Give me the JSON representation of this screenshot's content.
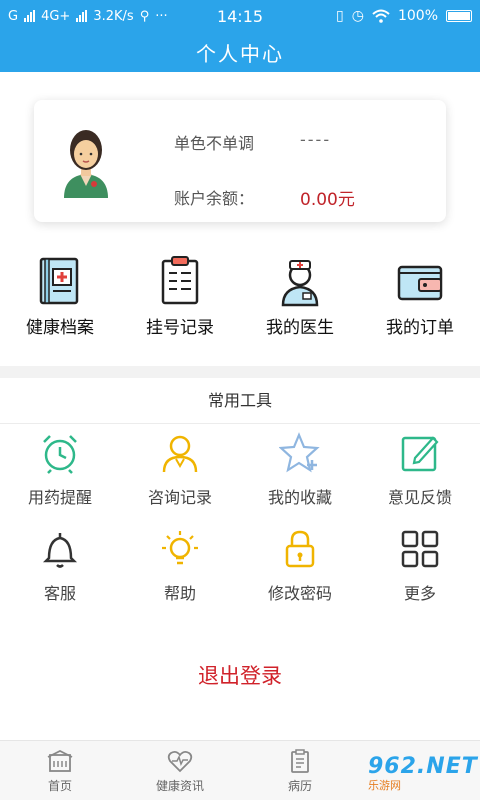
{
  "status_bar": {
    "left": "G",
    "network": "4G+",
    "speed": "3.2K/s",
    "extra": "···",
    "time": "14:15",
    "battery": "100%"
  },
  "header": {
    "title": "个人中心"
  },
  "profile": {
    "name_label": "单色不单调",
    "name_value": "----",
    "balance_label": "账户余额：",
    "balance_value": "0.00元"
  },
  "quick_actions": [
    {
      "label": "健康档案",
      "icon": "health-record-icon"
    },
    {
      "label": "挂号记录",
      "icon": "registration-record-icon"
    },
    {
      "label": "我的医生",
      "icon": "doctor-icon"
    },
    {
      "label": "我的订单",
      "icon": "order-wallet-icon"
    }
  ],
  "tools": {
    "title": "常用工具",
    "items": [
      {
        "label": "用药提醒",
        "icon": "alarm-clock-icon",
        "color": "#2eb88a"
      },
      {
        "label": "咨询记录",
        "icon": "user-consult-icon",
        "color": "#f0b400"
      },
      {
        "label": "我的收藏",
        "icon": "star-add-icon",
        "color": "#8fb6e0"
      },
      {
        "label": "意见反馈",
        "icon": "feedback-edit-icon",
        "color": "#2eb88a"
      },
      {
        "label": "客服",
        "icon": "bell-icon",
        "color": "#333333"
      },
      {
        "label": "帮助",
        "icon": "lightbulb-icon",
        "color": "#f0b400"
      },
      {
        "label": "修改密码",
        "icon": "lock-icon",
        "color": "#f0b400"
      },
      {
        "label": "更多",
        "icon": "grid-more-icon",
        "color": "#333333"
      }
    ]
  },
  "logout_label": "退出登录",
  "bottom_nav": [
    {
      "label": "首页",
      "icon": "home-building-icon"
    },
    {
      "label": "健康资讯",
      "icon": "heart-pulse-icon"
    },
    {
      "label": "病历",
      "icon": "medical-record-icon"
    },
    {
      "label": "",
      "icon": "user-icon"
    }
  ],
  "watermark": {
    "main": "962.NET",
    "sub": "乐游网"
  },
  "colors": {
    "primary": "#2ba4ea",
    "danger": "#d0222a",
    "balance": "#c0242a"
  }
}
